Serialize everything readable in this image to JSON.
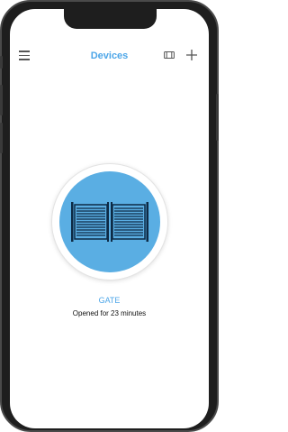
{
  "header": {
    "title": "Devices",
    "menu_icon": "hamburger-menu-icon",
    "view_icon": "cards-view-icon",
    "add_icon": "plus-icon"
  },
  "device": {
    "name": "GATE",
    "status": "Opened for 23 minutes",
    "icon": "gate-icon"
  },
  "colors": {
    "accent": "#4da6e8",
    "device_fill": "#5aaee3",
    "frame": "#1e1e1e"
  }
}
